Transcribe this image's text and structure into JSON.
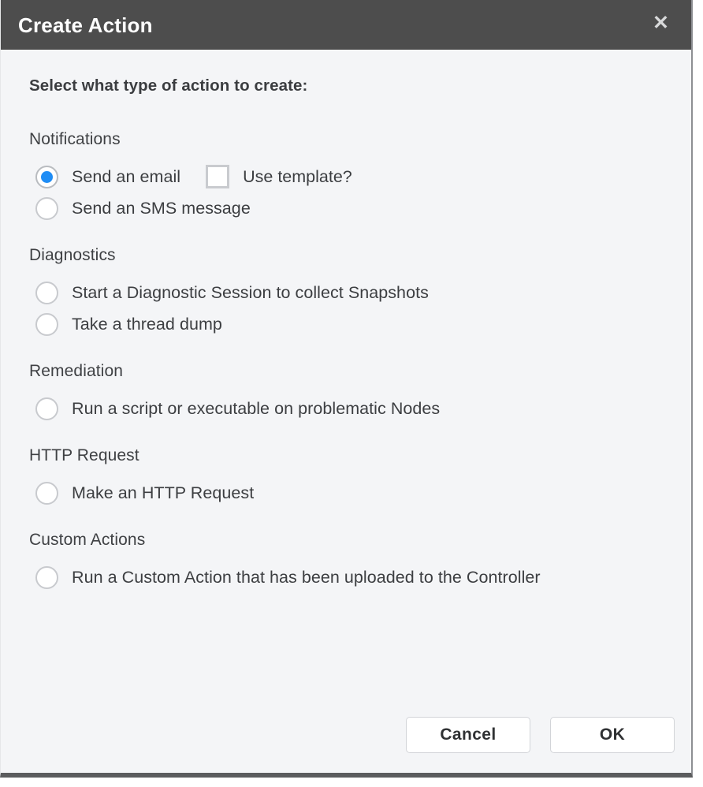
{
  "dialog": {
    "title": "Create Action",
    "close_icon": "close-icon",
    "prompt": "Select what type of action to create:",
    "accent_color": "#1f8df5",
    "titlebar_color": "#4d4d4d",
    "body_color": "#f4f5f7"
  },
  "groups": [
    {
      "label": "Notifications",
      "options": [
        {
          "label": "Send an email",
          "selected": true,
          "extra_checkbox": {
            "label": "Use template?",
            "checked": false
          }
        },
        {
          "label": "Send an SMS message",
          "selected": false
        }
      ]
    },
    {
      "label": "Diagnostics",
      "options": [
        {
          "label": "Start a Diagnostic Session to collect Snapshots",
          "selected": false
        },
        {
          "label": "Take a thread dump",
          "selected": false
        }
      ]
    },
    {
      "label": "Remediation",
      "options": [
        {
          "label": "Run a script or executable on problematic Nodes",
          "selected": false
        }
      ]
    },
    {
      "label": "HTTP Request",
      "options": [
        {
          "label": "Make an HTTP Request",
          "selected": false
        }
      ]
    },
    {
      "label": "Custom Actions",
      "options": [
        {
          "label": "Run a Custom Action that has been uploaded to the Controller",
          "selected": false
        }
      ]
    }
  ],
  "footer": {
    "cancel_label": "Cancel",
    "ok_label": "OK"
  }
}
